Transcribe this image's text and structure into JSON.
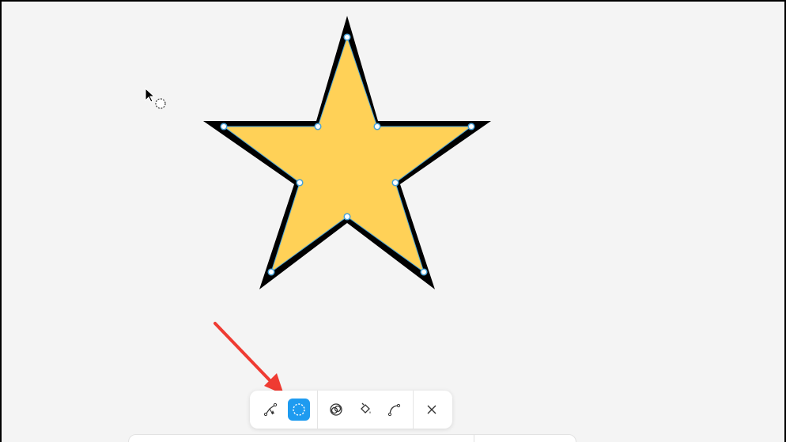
{
  "app": {
    "canvas_background": "#f4f4f4",
    "window_border": "#000000"
  },
  "shape": {
    "type": "star",
    "fill": "#ffd157",
    "stroke": "#000000",
    "selection_color": "#4aa3d8",
    "handle_count": 10
  },
  "annotation": {
    "arrow_color": "#ef3b32",
    "points_to": "lasso-select-button"
  },
  "cursor": {
    "icon": "pointer-with-lasso-icon"
  },
  "toolbar": {
    "active_color": "#1e9bf0",
    "buttons": [
      {
        "name": "edit-points-button",
        "icon": "pen-nodes-icon",
        "active": false
      },
      {
        "name": "lasso-select-button",
        "icon": "dashed-circle-icon",
        "active": true
      },
      {
        "name": "combine-shapes-button",
        "icon": "overlap-circles-icon",
        "active": false
      },
      {
        "name": "fill-button",
        "icon": "paint-bucket-icon",
        "active": false
      },
      {
        "name": "curve-button",
        "icon": "curve-path-icon",
        "active": false
      },
      {
        "name": "close-button",
        "icon": "close-icon",
        "active": false
      }
    ]
  }
}
